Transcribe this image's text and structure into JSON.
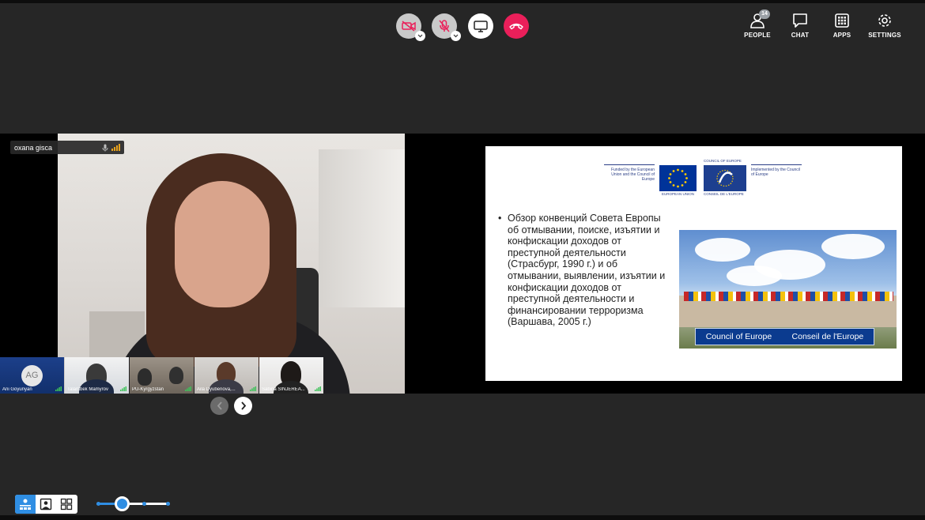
{
  "colors": {
    "accent": "#2f8ee3",
    "hangup": "#ea1f5a",
    "background": "#262626"
  },
  "controls": {
    "camera": {
      "icon": "camera-off-icon"
    },
    "mic": {
      "icon": "mic-off-icon"
    },
    "screen": {
      "icon": "screen-share-icon"
    },
    "hangup": {
      "icon": "hangup-icon"
    }
  },
  "menu": {
    "people": {
      "label": "PEOPLE",
      "count": "14",
      "icon": "people-icon"
    },
    "chat": {
      "label": "CHAT",
      "icon": "chat-icon"
    },
    "apps": {
      "label": "APPS",
      "icon": "apps-icon"
    },
    "settings": {
      "label": "SETTINGS",
      "icon": "gear-icon"
    }
  },
  "speaker": {
    "name": "oxana gisca"
  },
  "participants": [
    {
      "name": "Ani Goyunyan",
      "initials": "AG"
    },
    {
      "name": "Talantbek Mamyrov"
    },
    {
      "name": "PU-Kyrgyzstan"
    },
    {
      "name": "Aila Dyubenova,..."
    },
    {
      "name": "Sabina SINJEREA..."
    }
  ],
  "slide": {
    "logo_left": "Funded by the European Union and the Council of Europe",
    "eu_caption": "EUROPEAN UNION",
    "coe_top": "COUNCIL OF EUROPE",
    "coe_caption": "CONSEIL DE L'EUROPE",
    "logo_right": "Implemented by the Council of Europe",
    "bullet": "Обзор конвенций Совета Европы об отмывании, поиске, изъятии и конфискации доходов от преступной деятельности (Страсбург, 1990 г.) и об отмывании, выявлении, изъятии и конфискации доходов от преступной деятельности и финансировании терроризма (Варшава, 2005 г.)",
    "sign_left": "Council of Europe",
    "sign_right": "Conseil de l'Europe"
  },
  "layout_view": {
    "selected": "speaker",
    "zoom_level": 0.35
  }
}
